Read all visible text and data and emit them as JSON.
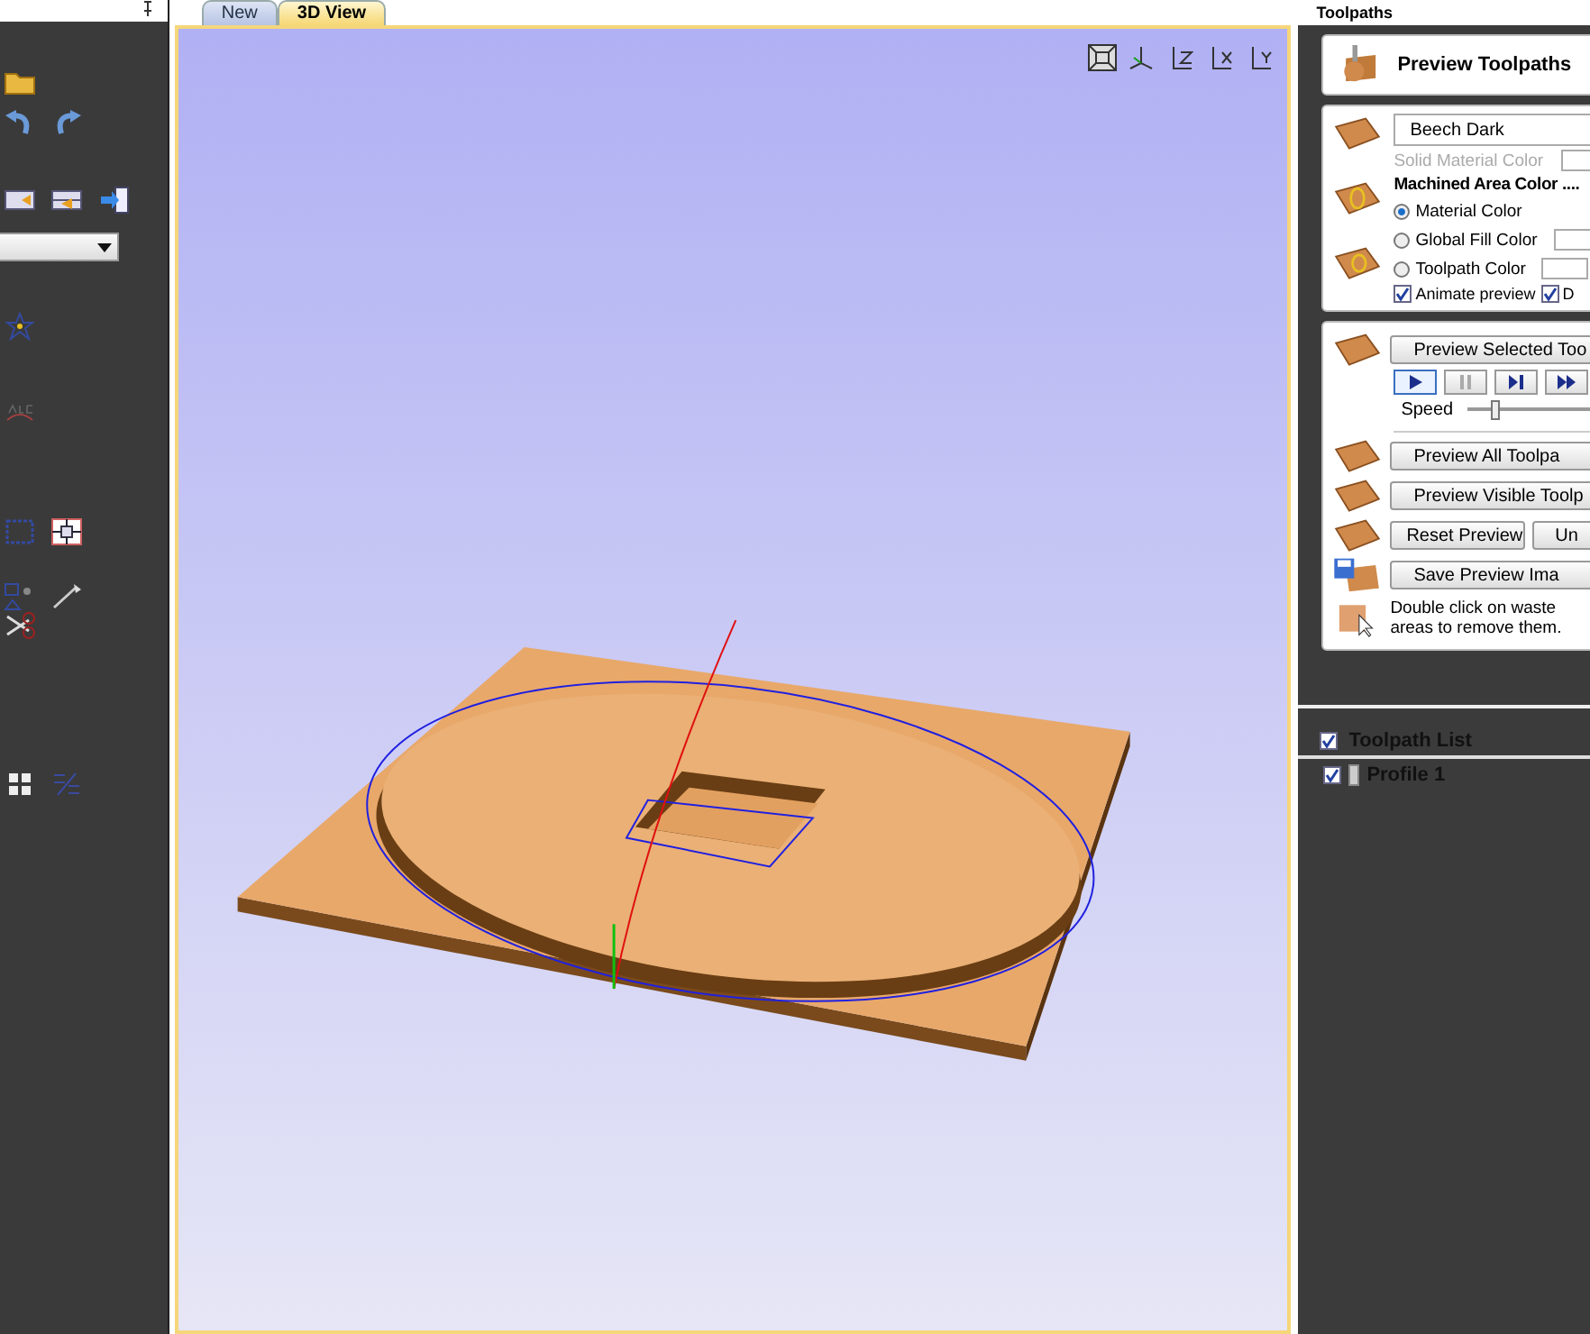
{
  "tabs": [
    {
      "label": "New",
      "selected": false
    },
    {
      "label": "3D View",
      "selected": true
    }
  ],
  "toolpaths_panel": {
    "title": "Toolpaths",
    "header": "Preview Toolpaths",
    "material": {
      "value": "Beech Dark"
    },
    "solid_material_color": {
      "label": "Solid Material Color",
      "disabled": true
    },
    "machined_area_heading": "Machined Area Color ....",
    "radios": [
      {
        "label": "Material Color",
        "selected": true,
        "kind": "plain"
      },
      {
        "label": "Global Fill Color",
        "selected": false,
        "kind": "color"
      },
      {
        "label": "Toolpath Color",
        "selected": false,
        "kind": "color"
      }
    ],
    "checkboxes": [
      {
        "label": "Animate preview",
        "checked": true
      },
      {
        "label": "D",
        "checked": true
      }
    ],
    "preview_selected": "Preview Selected Too",
    "playback": [
      {
        "kind": "play",
        "active": true
      },
      {
        "kind": "pause",
        "active": false
      },
      {
        "kind": "step",
        "active": false
      },
      {
        "kind": "fast",
        "active": false
      }
    ],
    "speed": {
      "label": "Speed",
      "level": 0.18
    },
    "preview_all": "Preview All Toolpa",
    "preview_visible": "Preview Visible Toolp",
    "reset": "Reset Preview",
    "undo": "Un",
    "save_image": "Save Preview Ima",
    "note": "Double click on waste areas to remove them."
  },
  "toolpath_list": {
    "title": "Toolpath List",
    "checked": true,
    "items": [
      {
        "name": "Profile 1",
        "checked": true
      }
    ]
  }
}
